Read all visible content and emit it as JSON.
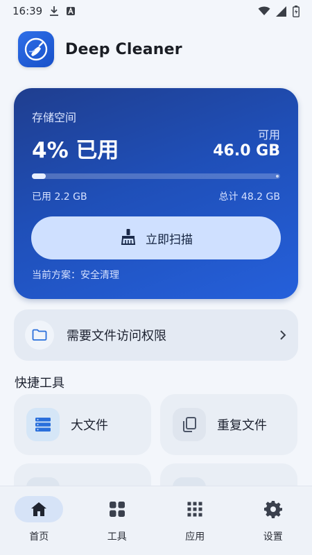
{
  "status_bar": {
    "time": "16:39",
    "icons": [
      "download-icon",
      "a-badge-icon",
      "wifi-icon",
      "cellular-icon",
      "battery-icon"
    ]
  },
  "app": {
    "title": "Deep Cleaner",
    "logo_icon": "broom-logo-icon"
  },
  "storage": {
    "label": "存储空间",
    "used_percent_text": "4% 已用",
    "used_fraction": 0.045,
    "available_label": "可用",
    "available_value": "46.0 GB",
    "used_text": "已用 2.2 GB",
    "total_text": "总计 48.2 GB",
    "scan_button_label": "立即扫描",
    "scan_icon": "brush-icon",
    "plan_text": "当前方案：安全清理"
  },
  "permission": {
    "text": "需要文件访问权限",
    "icon": "folder-icon",
    "chevron": "chevron-right-icon"
  },
  "quick_tools": {
    "title": "快捷工具",
    "items": [
      {
        "label": "大文件",
        "icon": "storage-icon",
        "icon_bg": "#d5e6f7",
        "icon_color": "#2a6fdb"
      },
      {
        "label": "重复文件",
        "icon": "copy-icon",
        "icon_bg": "#dfe5ee",
        "icon_color": "#4c5567"
      }
    ]
  },
  "bottom_nav": {
    "items": [
      {
        "label": "首页",
        "icon": "home-icon",
        "active": true
      },
      {
        "label": "工具",
        "icon": "grid-icon",
        "active": false
      },
      {
        "label": "应用",
        "icon": "apps-icon",
        "active": false
      },
      {
        "label": "设置",
        "icon": "gear-icon",
        "active": false
      }
    ]
  },
  "colors": {
    "accent": "#2560db",
    "card_dark": "#1f3e8f",
    "button_light": "#cfe0ff",
    "background": "#f3f6fb"
  }
}
